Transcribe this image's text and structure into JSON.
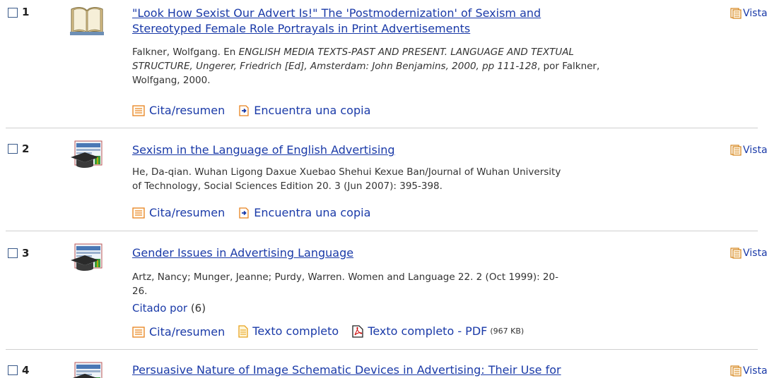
{
  "results": [
    {
      "number": "1",
      "title_l1": "\"Look How Sexist Our Advert Is!\" The 'Postmodernization' of Sexism and",
      "title_l2": "Stereotyped Female Role Portrayals in Print Advertisements",
      "authors_intro": "Falkner, Wolfgang. En ",
      "source_italic_l1": "ENGLISH MEDIA TEXTS-PAST AND PRESENT. LANGUAGE AND TEXTUAL",
      "source_italic_l2": "STRUCTURE, Ungerer, Friedrich [Ed], Amsterdam: John Benjamins, 2000, pp 111-128",
      "source_tail": ", por Falkner,",
      "source_l3": "Wolfgang, 2000.",
      "actions": [
        "Cita/resumen",
        "Encuentra una copia"
      ],
      "vista": "Vista",
      "thumb_icon": "book-icon"
    },
    {
      "number": "2",
      "title_l1": "Sexism in the Language of English Advertising",
      "meta_l1": "He, Da-qian. Wuhan Ligong Daxue Xuebao Shehui Kexue Ban/Journal of Wuhan University",
      "meta_l2": "of Technology, Social Sciences Edition 20. 3  (Jun 2007): 395-398.",
      "actions": [
        "Cita/resumen",
        "Encuentra una copia"
      ],
      "vista": "Vista",
      "thumb_icon": "scholarly-journal-icon"
    },
    {
      "number": "3",
      "title_l1": "Gender Issues in Advertising Language",
      "meta_l1": "Artz, Nancy; Munger, Jeanne; Purdy, Warren. Women and Language 22. 2  (Oct 1999): 20-",
      "meta_l2": "26.",
      "cited_by_label": "Citado por",
      "cited_by_count": "(6)",
      "actions": [
        "Cita/resumen",
        "Texto completo",
        "Texto completo - PDF"
      ],
      "pdf_size": "(967 KB)",
      "vista": "Vista",
      "thumb_icon": "scholarly-journal-icon"
    },
    {
      "number": "4",
      "title_l1": "Persuasive Nature of Image Schematic Devices in Advertising: Their Use for",
      "vista": "Vista",
      "thumb_icon": "scholarly-journal-icon"
    }
  ],
  "colors": {
    "link": "#1a3aa8",
    "text": "#333333",
    "icon_orange": "#e8821e",
    "divider": "#cfcfcf"
  }
}
